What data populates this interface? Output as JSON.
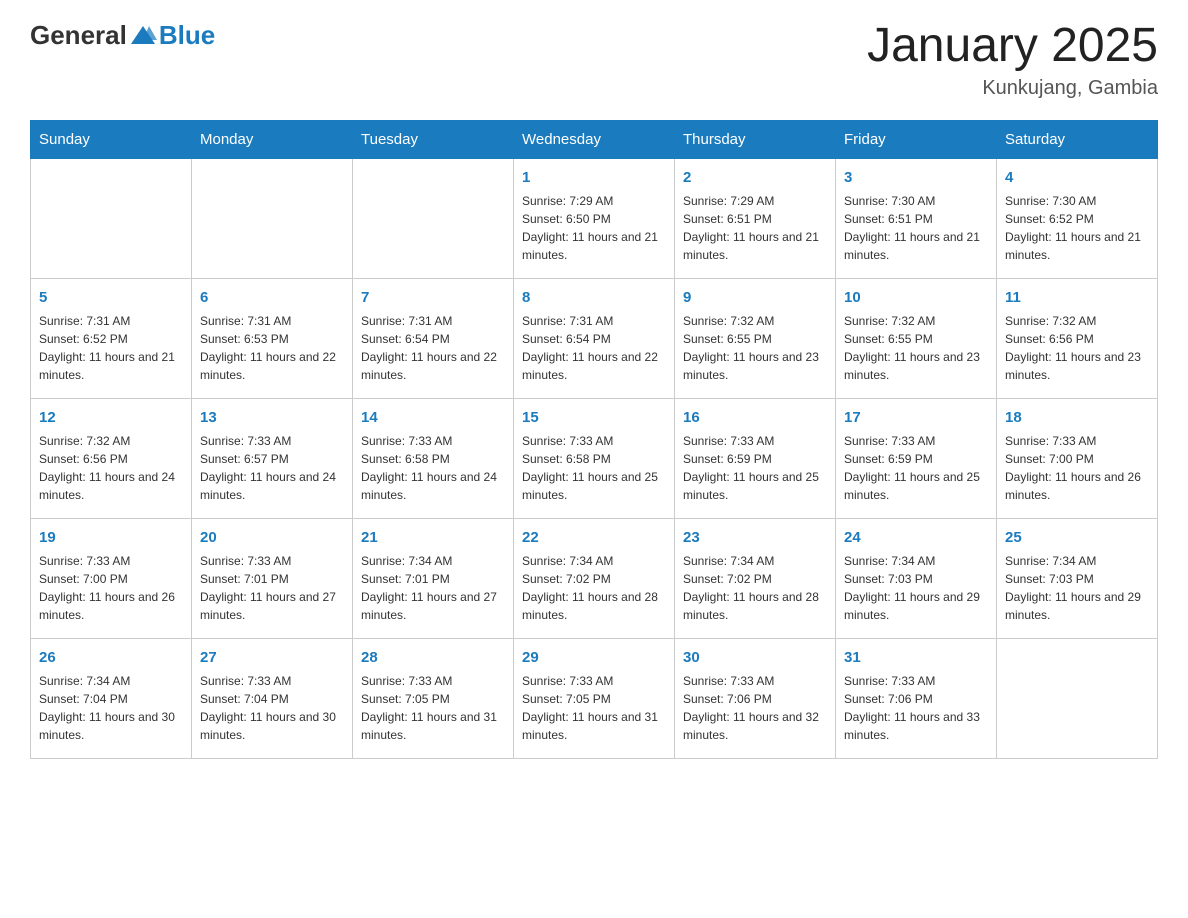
{
  "header": {
    "logo_general": "General",
    "logo_blue": "Blue",
    "month_year": "January 2025",
    "location": "Kunkujang, Gambia"
  },
  "weekdays": [
    "Sunday",
    "Monday",
    "Tuesday",
    "Wednesday",
    "Thursday",
    "Friday",
    "Saturday"
  ],
  "weeks": [
    [
      {
        "day": "",
        "info": ""
      },
      {
        "day": "",
        "info": ""
      },
      {
        "day": "",
        "info": ""
      },
      {
        "day": "1",
        "info": "Sunrise: 7:29 AM\nSunset: 6:50 PM\nDaylight: 11 hours and 21 minutes."
      },
      {
        "day": "2",
        "info": "Sunrise: 7:29 AM\nSunset: 6:51 PM\nDaylight: 11 hours and 21 minutes."
      },
      {
        "day": "3",
        "info": "Sunrise: 7:30 AM\nSunset: 6:51 PM\nDaylight: 11 hours and 21 minutes."
      },
      {
        "day": "4",
        "info": "Sunrise: 7:30 AM\nSunset: 6:52 PM\nDaylight: 11 hours and 21 minutes."
      }
    ],
    [
      {
        "day": "5",
        "info": "Sunrise: 7:31 AM\nSunset: 6:52 PM\nDaylight: 11 hours and 21 minutes."
      },
      {
        "day": "6",
        "info": "Sunrise: 7:31 AM\nSunset: 6:53 PM\nDaylight: 11 hours and 22 minutes."
      },
      {
        "day": "7",
        "info": "Sunrise: 7:31 AM\nSunset: 6:54 PM\nDaylight: 11 hours and 22 minutes."
      },
      {
        "day": "8",
        "info": "Sunrise: 7:31 AM\nSunset: 6:54 PM\nDaylight: 11 hours and 22 minutes."
      },
      {
        "day": "9",
        "info": "Sunrise: 7:32 AM\nSunset: 6:55 PM\nDaylight: 11 hours and 23 minutes."
      },
      {
        "day": "10",
        "info": "Sunrise: 7:32 AM\nSunset: 6:55 PM\nDaylight: 11 hours and 23 minutes."
      },
      {
        "day": "11",
        "info": "Sunrise: 7:32 AM\nSunset: 6:56 PM\nDaylight: 11 hours and 23 minutes."
      }
    ],
    [
      {
        "day": "12",
        "info": "Sunrise: 7:32 AM\nSunset: 6:56 PM\nDaylight: 11 hours and 24 minutes."
      },
      {
        "day": "13",
        "info": "Sunrise: 7:33 AM\nSunset: 6:57 PM\nDaylight: 11 hours and 24 minutes."
      },
      {
        "day": "14",
        "info": "Sunrise: 7:33 AM\nSunset: 6:58 PM\nDaylight: 11 hours and 24 minutes."
      },
      {
        "day": "15",
        "info": "Sunrise: 7:33 AM\nSunset: 6:58 PM\nDaylight: 11 hours and 25 minutes."
      },
      {
        "day": "16",
        "info": "Sunrise: 7:33 AM\nSunset: 6:59 PM\nDaylight: 11 hours and 25 minutes."
      },
      {
        "day": "17",
        "info": "Sunrise: 7:33 AM\nSunset: 6:59 PM\nDaylight: 11 hours and 25 minutes."
      },
      {
        "day": "18",
        "info": "Sunrise: 7:33 AM\nSunset: 7:00 PM\nDaylight: 11 hours and 26 minutes."
      }
    ],
    [
      {
        "day": "19",
        "info": "Sunrise: 7:33 AM\nSunset: 7:00 PM\nDaylight: 11 hours and 26 minutes."
      },
      {
        "day": "20",
        "info": "Sunrise: 7:33 AM\nSunset: 7:01 PM\nDaylight: 11 hours and 27 minutes."
      },
      {
        "day": "21",
        "info": "Sunrise: 7:34 AM\nSunset: 7:01 PM\nDaylight: 11 hours and 27 minutes."
      },
      {
        "day": "22",
        "info": "Sunrise: 7:34 AM\nSunset: 7:02 PM\nDaylight: 11 hours and 28 minutes."
      },
      {
        "day": "23",
        "info": "Sunrise: 7:34 AM\nSunset: 7:02 PM\nDaylight: 11 hours and 28 minutes."
      },
      {
        "day": "24",
        "info": "Sunrise: 7:34 AM\nSunset: 7:03 PM\nDaylight: 11 hours and 29 minutes."
      },
      {
        "day": "25",
        "info": "Sunrise: 7:34 AM\nSunset: 7:03 PM\nDaylight: 11 hours and 29 minutes."
      }
    ],
    [
      {
        "day": "26",
        "info": "Sunrise: 7:34 AM\nSunset: 7:04 PM\nDaylight: 11 hours and 30 minutes."
      },
      {
        "day": "27",
        "info": "Sunrise: 7:33 AM\nSunset: 7:04 PM\nDaylight: 11 hours and 30 minutes."
      },
      {
        "day": "28",
        "info": "Sunrise: 7:33 AM\nSunset: 7:05 PM\nDaylight: 11 hours and 31 minutes."
      },
      {
        "day": "29",
        "info": "Sunrise: 7:33 AM\nSunset: 7:05 PM\nDaylight: 11 hours and 31 minutes."
      },
      {
        "day": "30",
        "info": "Sunrise: 7:33 AM\nSunset: 7:06 PM\nDaylight: 11 hours and 32 minutes."
      },
      {
        "day": "31",
        "info": "Sunrise: 7:33 AM\nSunset: 7:06 PM\nDaylight: 11 hours and 33 minutes."
      },
      {
        "day": "",
        "info": ""
      }
    ]
  ]
}
